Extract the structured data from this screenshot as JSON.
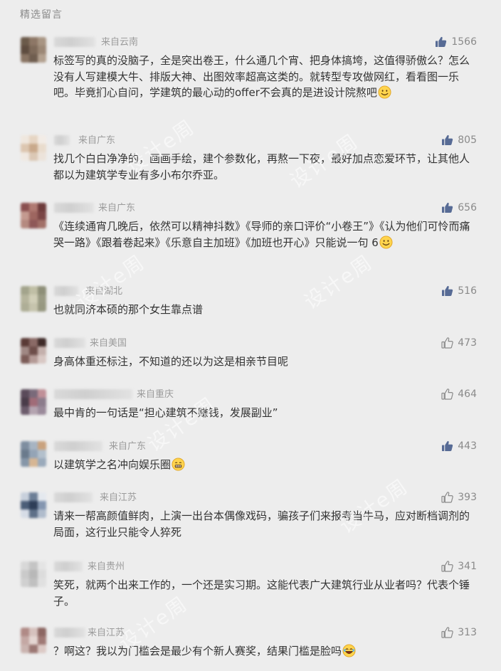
{
  "section_title": "精选留言",
  "watermark_text": "设计e周",
  "comments": [
    {
      "location": "来自云南",
      "likes": "1566",
      "liked": true,
      "text": "标签写的真的没脑子，全是突出卷王，什么通几个宵、把身体搞垮，这值得骄傲么？怎么没有人写建模大牛、排版大神、出图效率超高这类的。就转型专攻做网红，看看图一乐吧。毕竟扪心自问，学建筑的最心动的offer不会真的是进设计院熬吧",
      "emoji": "smile",
      "avatar_colors": [
        "#6b5a4a",
        "#8d7766",
        "#a89583",
        "#5e4c3f",
        "#7e6a5a",
        "#9c8876",
        "#8a7564",
        "#6f5d4f",
        "#b3a190"
      ]
    },
    {
      "location": "来自广东",
      "likes": "805",
      "liked": true,
      "text": "找几个白白净净的，画画手绘，建个参数化，再熬一下夜，最好加点恋爱环节，让其他人都以为建筑学专业有多小布尔乔亚。",
      "emoji": "",
      "avatar_colors": [
        "#efe7de",
        "#e6d5c3",
        "#f2ece6",
        "#dcc6b0",
        "#c9a98b",
        "#e9dccd",
        "#f0e9e2",
        "#dbc8b5",
        "#ece3da"
      ]
    },
    {
      "location": "来自广东",
      "likes": "656",
      "liked": true,
      "text": "《连续通宵几晚后，依然可以精神抖数》《导师的亲口评价“小卷王”》《认为他们可怜而痛哭一路》《跟着卷起来》《乐意自主加班》《加班也开心》只能说一句 6",
      "emoji": "smile",
      "avatar_colors": [
        "#8a4f4f",
        "#b07a72",
        "#6d3b3b",
        "#c49a90",
        "#9e6660",
        "#7a4545",
        "#b58a80",
        "#8e5858",
        "#a27068"
      ]
    },
    {
      "location": "来自湖北",
      "likes": "516",
      "liked": true,
      "text": "也就同济本硕的那个女生靠点谱",
      "emoji": "",
      "avatar_colors": [
        "#a3a48c",
        "#c0bfa6",
        "#8e8f78",
        "#b6b59d",
        "#d1cfb8",
        "#9a9b84",
        "#aeae96",
        "#c6c4ad",
        "#979880"
      ]
    },
    {
      "location": "来自美国",
      "likes": "473",
      "liked": false,
      "text": "身高体重还标注，不知道的还以为这是相亲节目呢",
      "emoji": "",
      "avatar_colors": [
        "#5a3a36",
        "#8a6a66",
        "#3e2a28",
        "#a08884",
        "#6e4e4a",
        "#c4b0ac",
        "#7c5c58",
        "#b49a96",
        "#d8c8c4"
      ]
    },
    {
      "location": "来自重庆",
      "likes": "464",
      "liked": false,
      "text": "最中肯的一句话是“担心建筑不赚钱，发展副业”",
      "emoji": "",
      "avatar_colors": [
        "#5a4a5a",
        "#7a6a7a",
        "#c09098",
        "#4a3c4a",
        "#a06c78",
        "#8c7c8c",
        "#6c5c6c",
        "#b4a4b0",
        "#9a8a9a"
      ]
    },
    {
      "location": "来自广东",
      "likes": "443",
      "liked": true,
      "text": "以建筑学之名冲向娱乐圈",
      "emoji": "grimace",
      "avatar_colors": [
        "#7e8ea0",
        "#a7b4c2",
        "#c9a27e",
        "#6a7a8c",
        "#94a4b6",
        "#b3c0cc",
        "#8696a8",
        "#d6b694",
        "#9aaabb"
      ]
    },
    {
      "location": "来自江苏",
      "likes": "393",
      "liked": false,
      "text": "请来一帮高颜值鲜肉，上演一出台本偶像戏码，骗孩子们来报考当牛马，应对断档调剂的局面，这行业只能令人猝死",
      "emoji": "",
      "avatar_colors": [
        "#c8d0dc",
        "#6c7e96",
        "#e4e8ee",
        "#4c5e78",
        "#2e3e58",
        "#8496b0",
        "#d6dce6",
        "#5e7088",
        "#b0bccc"
      ]
    },
    {
      "location": "来自贵州",
      "likes": "341",
      "liked": false,
      "text": "笑死，就两个出来工作的，一个还是实习期。这能代表广大建筑行业从业者吗？代表个锤子。",
      "emoji": "",
      "avatar_colors": [
        "#d8d8d8",
        "#c4c4c4",
        "#e4e4e4",
        "#cacaca",
        "#b8b8b8",
        "#dcdcdc",
        "#d0d0d0",
        "#c0c0c0",
        "#e0e0e0"
      ]
    },
    {
      "location": "来自江苏",
      "likes": "313",
      "liked": false,
      "text": "？啊这？我以为门槛会是最少有个新人赛奖，结果门槛是脸吗",
      "emoji": "laugh",
      "avatar_colors": [
        "#b08a86",
        "#d6c2be",
        "#8c6662",
        "#c4a8a4",
        "#e4d6d2",
        "#a07a76",
        "#cab4b0",
        "#9c7874",
        "#dccac6"
      ]
    }
  ]
}
